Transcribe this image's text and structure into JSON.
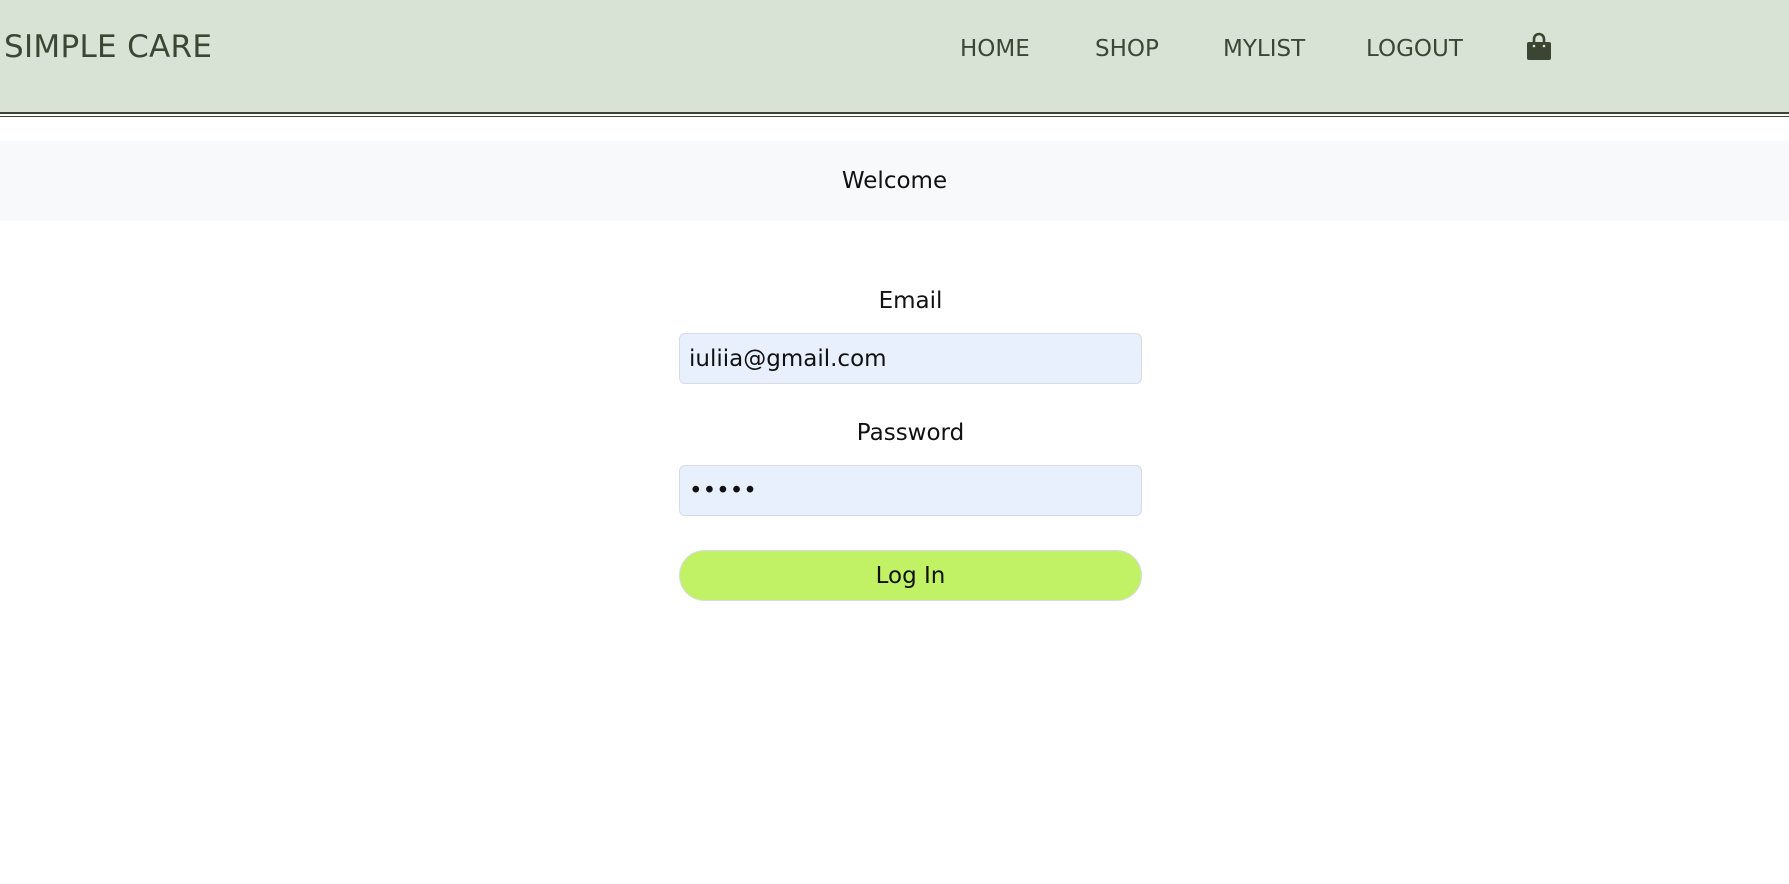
{
  "header": {
    "brand": "SIMPLE CARE",
    "nav": {
      "home": "HOME",
      "shop": "SHOP",
      "mylist": "MYLIST",
      "logout": "LOGOUT"
    },
    "cart_icon": "shopping-bag-icon"
  },
  "welcome": {
    "text": "Welcome"
  },
  "login_form": {
    "email_label": "Email",
    "email_value": "iuliia@gmail.com",
    "password_label": "Password",
    "password_value": "•••••",
    "submit_label": "Log In"
  },
  "colors": {
    "header_bg": "#d8e3d5",
    "header_text": "#3d4535",
    "input_bg": "#e8f0fe",
    "button_bg": "#c1f266"
  }
}
